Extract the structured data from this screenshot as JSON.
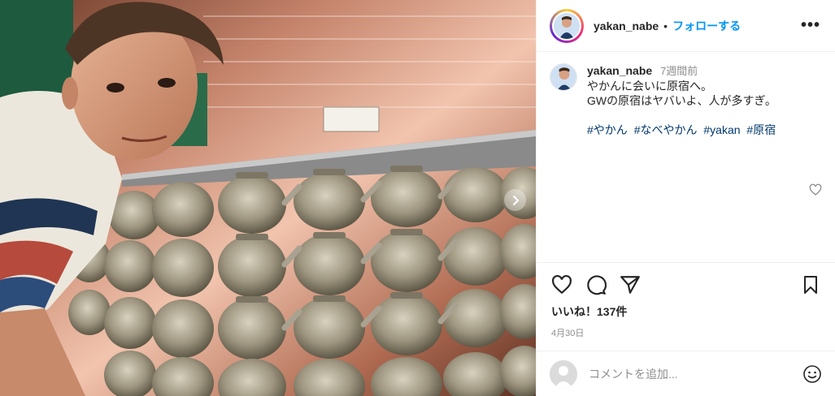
{
  "post": {
    "image_alt": "Man posing next to a wall of stacked silver kettles",
    "carousel_next_icon": "chevron-right-icon"
  },
  "header": {
    "username": "yakan_nabe",
    "separator": "•",
    "follow_label": "フォローする",
    "more_icon": "ellipsis-icon",
    "more_label": "•••"
  },
  "caption": {
    "username": "yakan_nabe",
    "time": "7週間前",
    "line1": "やかんに会いに原宿へ。",
    "line2": "GWの原宿はヤバいよ、人が多すぎ。",
    "hashtags": [
      "#やかん",
      "#なべやかん",
      "#yakan",
      "#原宿"
    ]
  },
  "actions": {
    "like_icon": "heart-icon",
    "comment_icon": "comment-icon",
    "share_icon": "paper-plane-icon",
    "save_icon": "bookmark-icon"
  },
  "likes_text": "いいね！137件",
  "date_text": "4月30日",
  "comment": {
    "placeholder": "コメントを追加...",
    "emoji_icon": "smiley-icon"
  },
  "colors": {
    "link_blue": "#0095f6",
    "hashtag": "#00376b",
    "muted": "#8e8e8e",
    "border": "#efefef"
  }
}
